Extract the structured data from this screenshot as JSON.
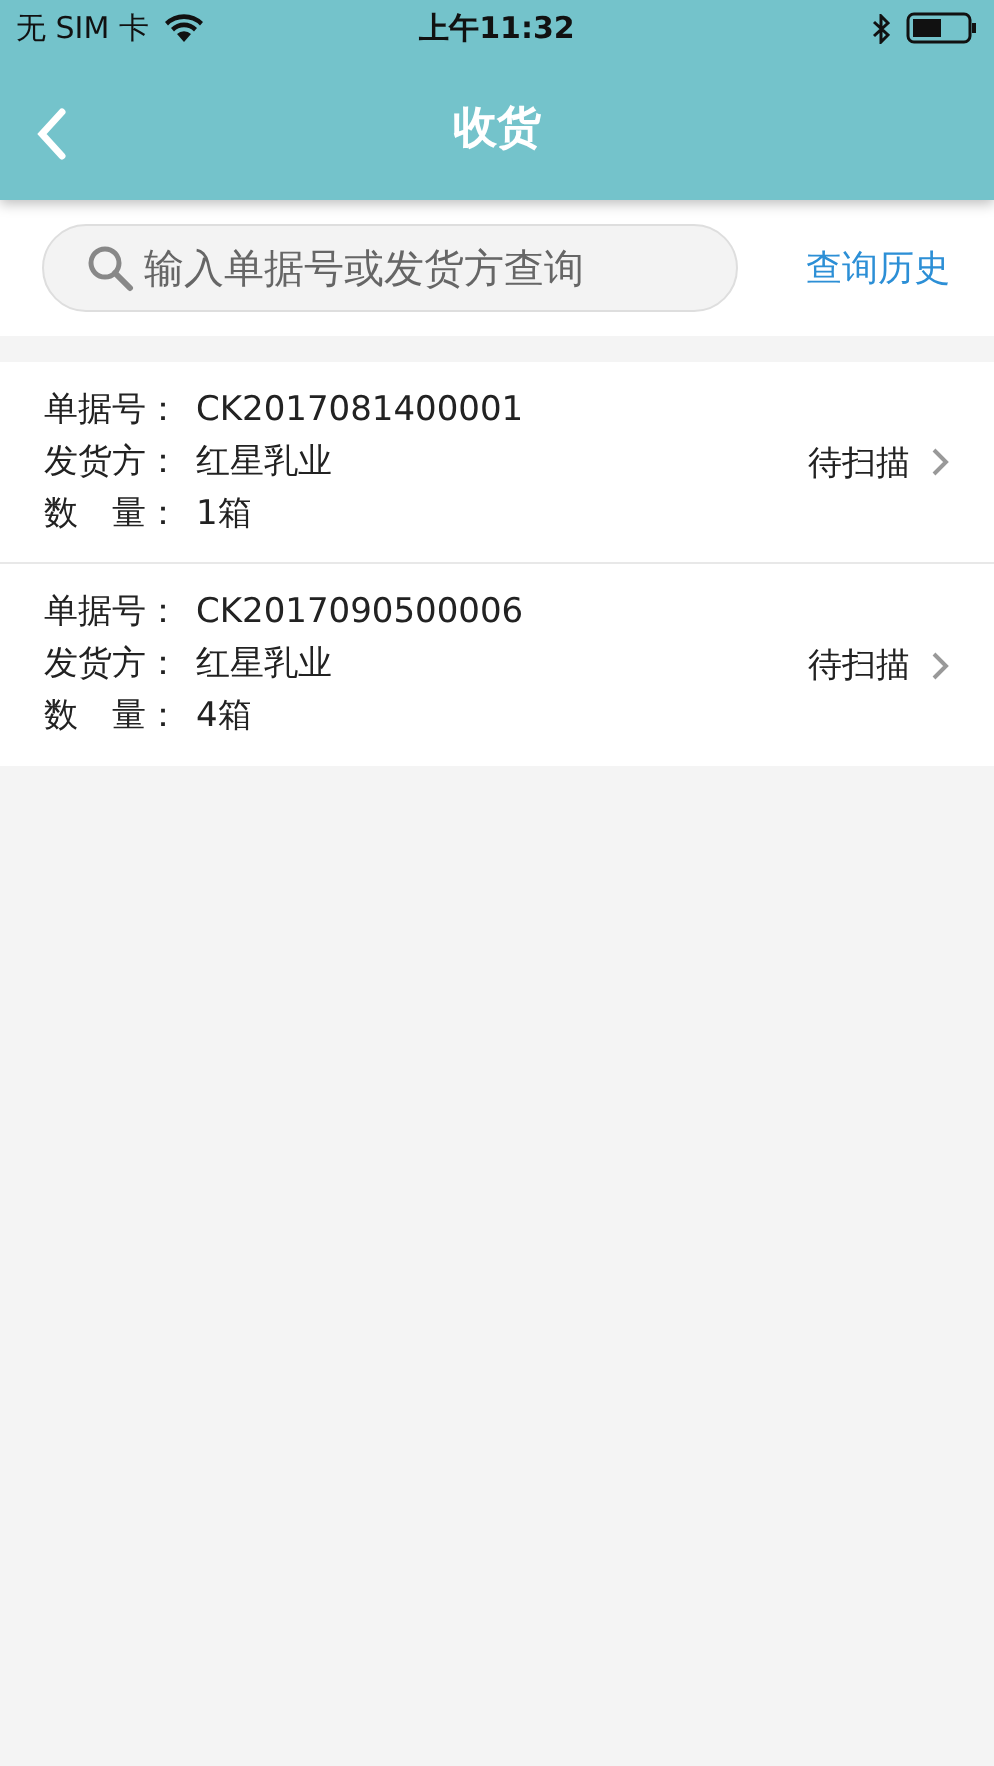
{
  "status_bar": {
    "carrier": "无 SIM 卡",
    "time": "上午11:32"
  },
  "nav": {
    "title": "收货"
  },
  "search": {
    "placeholder": "输入单据号或发货方查询",
    "history_link": "查询历史"
  },
  "orders": [
    {
      "fields": [
        {
          "label": "单据号：",
          "value": "CK2017081400001"
        },
        {
          "label": "发货方：",
          "value": "红星乳业"
        },
        {
          "label": "数　量：",
          "value": "1箱"
        }
      ],
      "status": "待扫描"
    },
    {
      "fields": [
        {
          "label": "单据号：",
          "value": "CK2017090500006"
        },
        {
          "label": "发货方：",
          "value": "红星乳业"
        },
        {
          "label": "数　量：",
          "value": "4箱"
        }
      ],
      "status": "待扫描"
    }
  ]
}
